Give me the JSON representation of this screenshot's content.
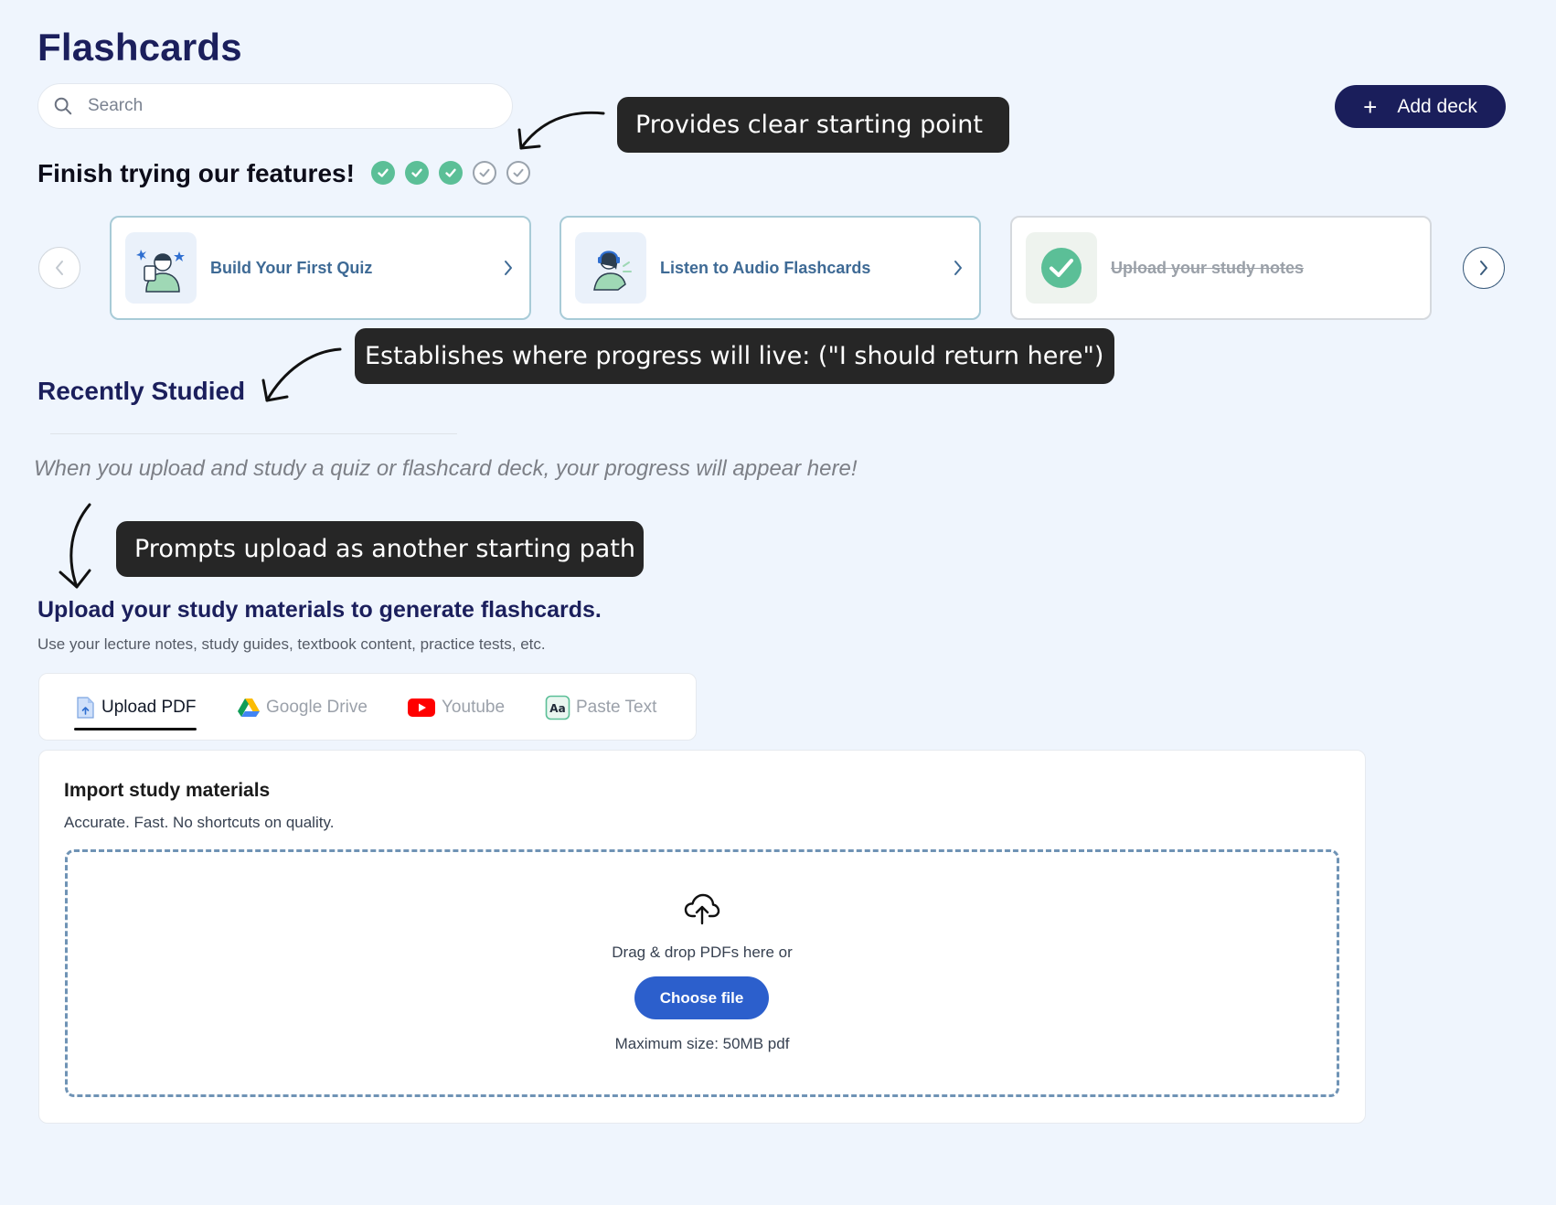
{
  "header": {
    "title": "Flashcards",
    "search_placeholder": "Search",
    "add_deck_label": "Add deck"
  },
  "annotations": [
    "Provides clear starting point",
    "Establishes where progress will live: (\"I should return here\")",
    "Prompts upload as another starting path"
  ],
  "features": {
    "title": "Finish trying our features!",
    "progress": {
      "completed": 3,
      "total": 5
    },
    "cards": [
      {
        "label": "Build Your First Quiz",
        "completed": false
      },
      {
        "label": "Listen to Audio Flashcards",
        "completed": false
      },
      {
        "label": "Upload your study notes",
        "completed": true
      }
    ]
  },
  "recent": {
    "title": "Recently Studied",
    "empty_message": "When you upload and study a quiz or flashcard deck, your progress will appear here!"
  },
  "upload": {
    "title": "Upload your study materials to generate flashcards.",
    "subtitle": "Use your lecture notes, study guides, textbook content, practice tests, etc.",
    "tabs": [
      {
        "label": "Upload PDF",
        "icon": "pdf-upload-icon",
        "active": true
      },
      {
        "label": "Google Drive",
        "icon": "google-drive-icon",
        "active": false
      },
      {
        "label": "Youtube",
        "icon": "youtube-icon",
        "active": false
      },
      {
        "label": "Paste Text",
        "icon": "paste-text-icon",
        "active": false
      }
    ],
    "import": {
      "title": "Import study materials",
      "subtitle": "Accurate. Fast. No shortcuts on quality.",
      "drop_text": "Drag & drop PDFs here or",
      "button_label": "Choose file",
      "limit_text": "Maximum size: 50MB pdf"
    }
  },
  "colors": {
    "background": "#eff5fd",
    "primary_navy": "#1a1e5b",
    "accent_blue": "#2c5fcc",
    "success_green": "#5bbf97",
    "callout_dark": "#262626"
  }
}
